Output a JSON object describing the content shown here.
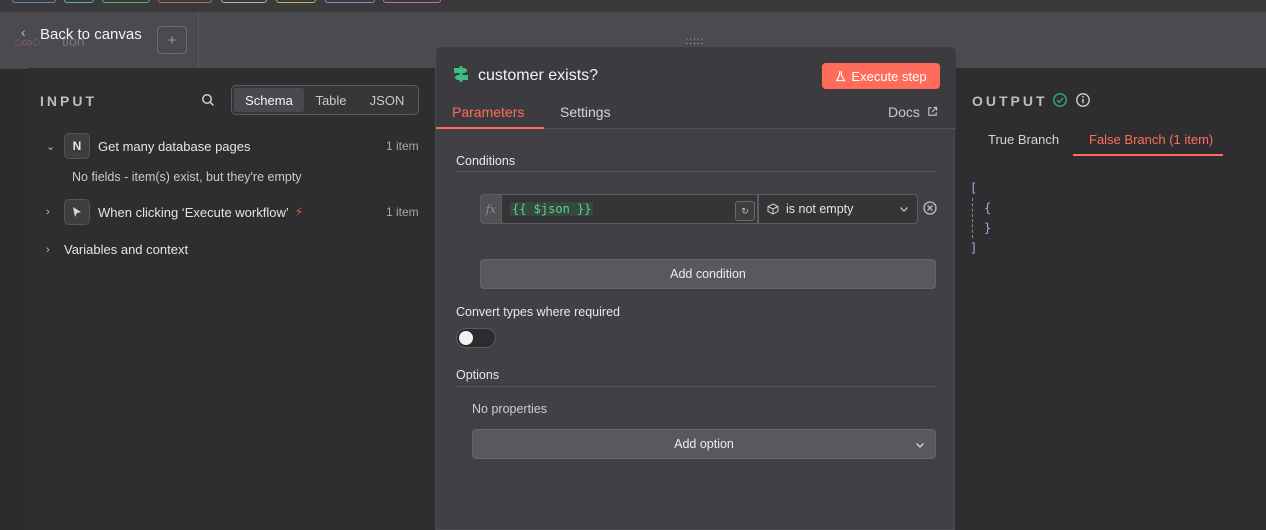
{
  "canvas": {
    "back_label": "Back to canvas",
    "ghost_text": "tion",
    "add_label": "+"
  },
  "input": {
    "title": "INPUT",
    "view_tabs": [
      "Schema",
      "Table",
      "JSON"
    ],
    "active_view": "Schema",
    "nodes": [
      {
        "icon": "N",
        "label": "Get many database pages",
        "count": "1 item",
        "expanded": true,
        "note": "No fields - item(s) exist, but they're empty"
      },
      {
        "icon": "cursor-icon",
        "label": "When clicking ‘Execute workflow’",
        "count": "1 item",
        "expanded": false
      }
    ],
    "variables_label": "Variables and context"
  },
  "node": {
    "title": "customer exists?",
    "execute_label": "Execute step",
    "tabs": [
      "Parameters",
      "Settings"
    ],
    "active_tab": "Parameters",
    "docs_label": "Docs",
    "conditions_label": "Conditions",
    "condition": {
      "fx_label": "fx",
      "expression": "{{ $json }}",
      "operator": "is not empty"
    },
    "add_condition_label": "Add condition",
    "convert_types_label": "Convert types where required",
    "convert_types_enabled": false,
    "options_label": "Options",
    "no_properties_label": "No properties",
    "add_option_label": "Add option"
  },
  "output": {
    "title": "OUTPUT",
    "tabs": [
      "True Branch",
      "False Branch (1 item)"
    ],
    "active_tab": "False Branch (1 item)",
    "json_lines": [
      "[",
      "{",
      "}",
      "]"
    ]
  },
  "colors": {
    "accent": "#ff6d5a",
    "success": "#2fb26f",
    "expression_green": "#5fcf94"
  }
}
